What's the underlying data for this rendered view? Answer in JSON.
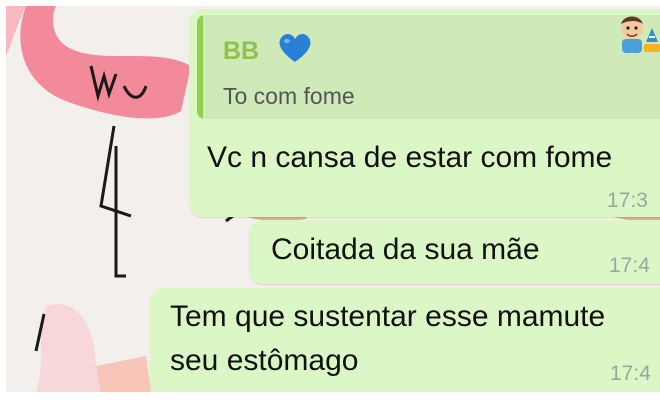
{
  "chat": {
    "messages": [
      {
        "quoted": {
          "sender": "BB",
          "sender_emoji": "blue-heart",
          "text": "To com fome"
        },
        "text": "Vc n cansa de estar com fome",
        "time": "17:3"
      },
      {
        "text": "Coitada da sua mãe",
        "time": "17:4"
      },
      {
        "text_line1": "Tem que sustentar esse mamute",
        "text_line2": "seu estômago",
        "time": "17:4"
      }
    ]
  },
  "colors": {
    "bubble_out": "#dcf7c6",
    "quote_bg": "#cfe9b8",
    "quote_bar": "#8fd14f",
    "quote_sender": "#8fc24d",
    "timestamp": "#9aa6a0",
    "heart": "#2b7fd6"
  }
}
